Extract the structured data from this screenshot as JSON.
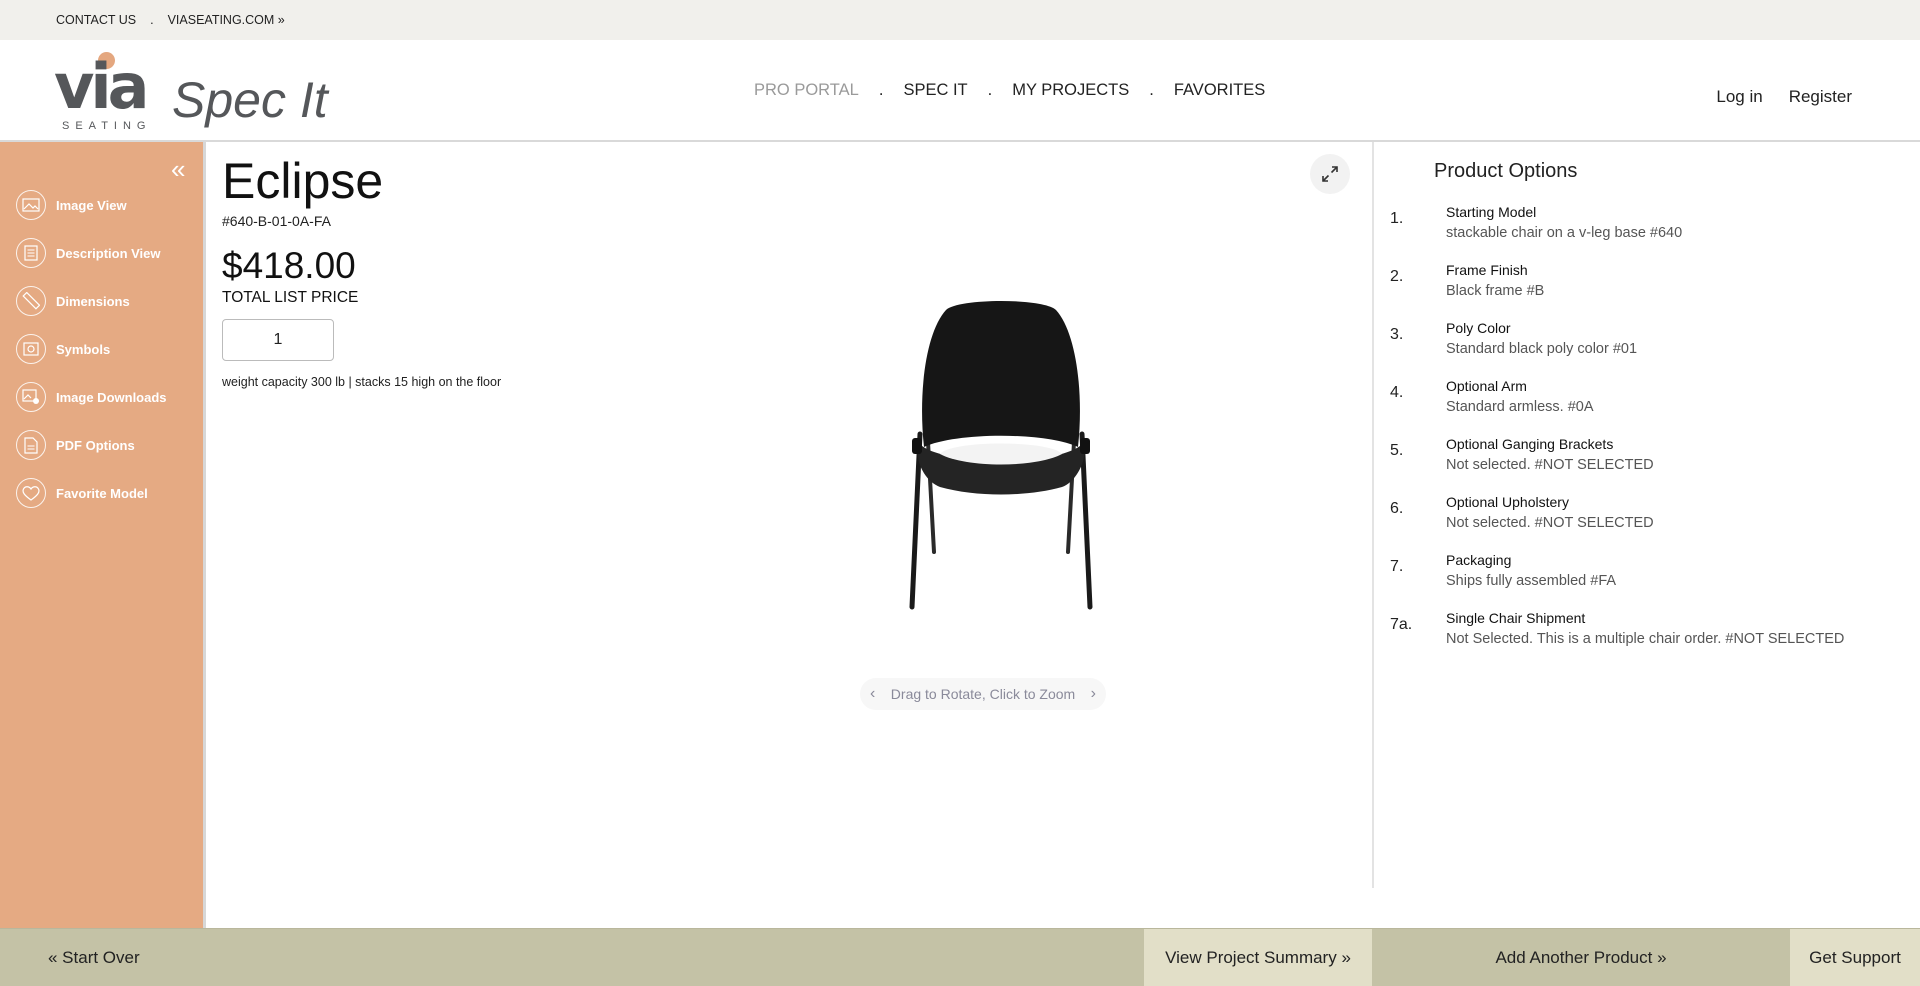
{
  "utility": {
    "contact_label": "CONTACT US",
    "separator": ".",
    "site_label": "VIASEATING.COM »"
  },
  "header": {
    "logo_text": "via",
    "logo_subtext": "SEATING",
    "app_name": "Spec It",
    "nav": [
      {
        "label": "PRO PORTAL"
      },
      {
        "label": "SPEC IT"
      },
      {
        "label": "MY PROJECTS"
      },
      {
        "label": "FAVORITES"
      }
    ],
    "separator": ".",
    "login_label": "Log in",
    "register_label": "Register"
  },
  "sidebar": {
    "collapse_glyph": "«",
    "items": [
      {
        "label": "Image View",
        "icon": "image-icon"
      },
      {
        "label": "Description View",
        "icon": "list-icon"
      },
      {
        "label": "Dimensions",
        "icon": "ruler-icon"
      },
      {
        "label": "Symbols",
        "icon": "symbol-icon"
      },
      {
        "label": "Image Downloads",
        "icon": "image-download-icon"
      },
      {
        "label": "PDF Options",
        "icon": "pdf-icon"
      },
      {
        "label": "Favorite Model",
        "icon": "heart-icon"
      }
    ]
  },
  "product": {
    "name": "Eclipse",
    "sku": "#640-B-01-0A-FA",
    "price": "$418.00",
    "price_label": "TOTAL LIST PRICE",
    "quantity": "1",
    "specs": "weight capacity 300 lb | stacks 15 high on the floor",
    "viewer_hint": "Drag to Rotate, Click to Zoom",
    "prev_glyph": "‹",
    "next_glyph": "›"
  },
  "options": {
    "title": "Product Options",
    "items": [
      {
        "num": "1.",
        "name": "Starting Model",
        "value": "stackable chair on a v-leg base #640"
      },
      {
        "num": "2.",
        "name": "Frame Finish",
        "value": "Black frame #B"
      },
      {
        "num": "3.",
        "name": "Poly Color",
        "value": "Standard black poly color #01"
      },
      {
        "num": "4.",
        "name": "Optional Arm",
        "value": "Standard armless. #0A"
      },
      {
        "num": "5.",
        "name": "Optional Ganging Brackets",
        "value": "Not selected. #NOT SELECTED"
      },
      {
        "num": "6.",
        "name": "Optional Upholstery",
        "value": "Not selected. #NOT SELECTED"
      },
      {
        "num": "7.",
        "name": "Packaging",
        "value": "Ships fully assembled #FA"
      },
      {
        "num": "7a.",
        "name": "Single Chair Shipment",
        "value": "Not Selected. This is a multiple chair order. #NOT SELECTED"
      }
    ]
  },
  "footer": {
    "start_over": "« Start Over",
    "view_summary": "View Project Summary »",
    "add_product": "Add Another Product »",
    "get_support": "Get Support"
  },
  "colors": {
    "sidebar": "#e5aa83",
    "footer": "#c4c2a6",
    "footer_highlight": "#e2dfc8",
    "utility_bar": "#f1f0ec",
    "logo_gray": "#55575a"
  }
}
